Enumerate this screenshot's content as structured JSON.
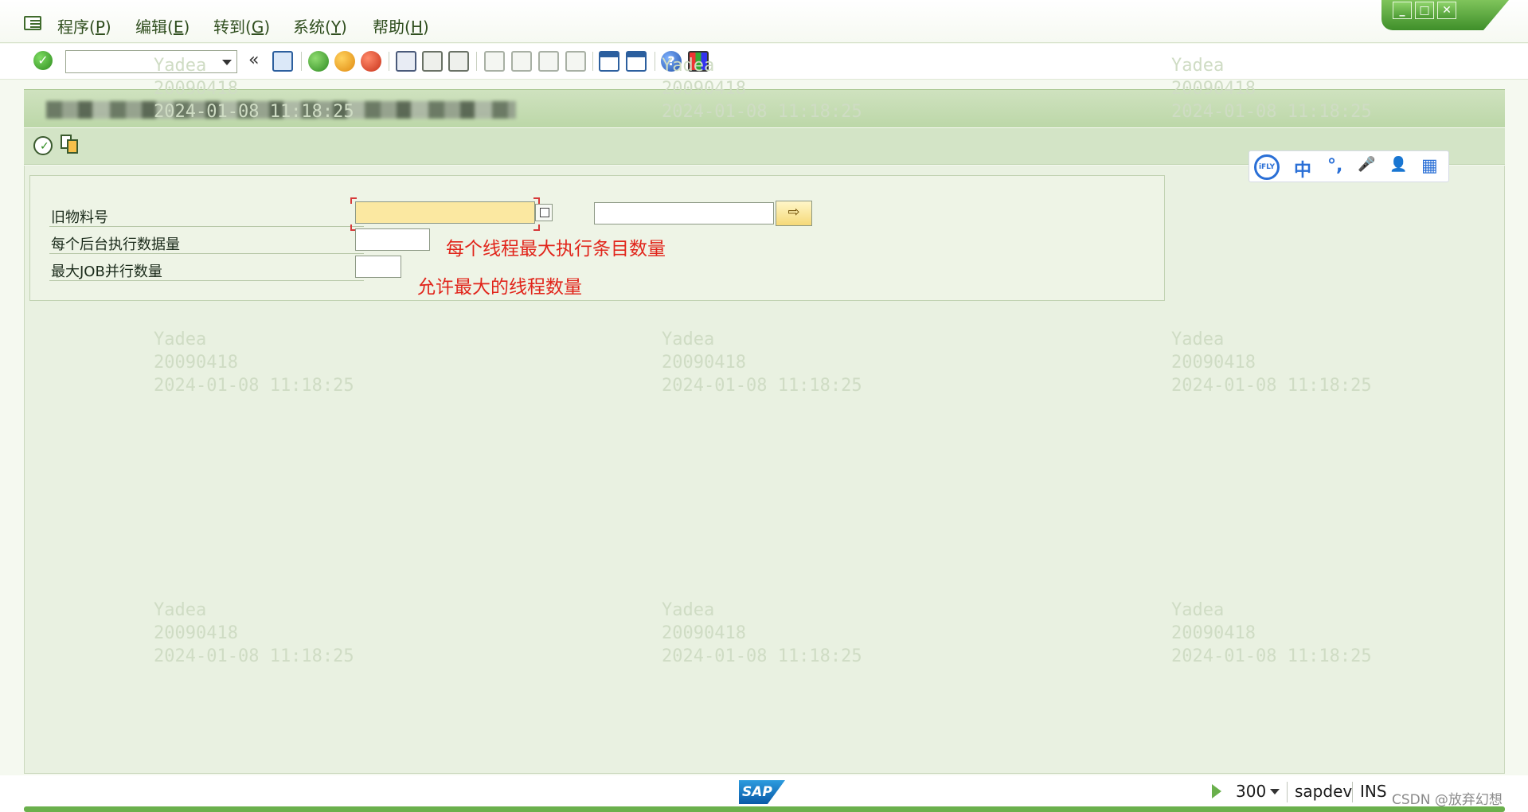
{
  "menu": {
    "items": [
      {
        "label": "程序(",
        "key": "P",
        "suffix": ")"
      },
      {
        "label": "编辑(",
        "key": "E",
        "suffix": ")"
      },
      {
        "label": "转到(",
        "key": "G",
        "suffix": ")"
      },
      {
        "label": "系统(",
        "key": "Y",
        "suffix": ")"
      },
      {
        "label": "帮助(",
        "key": "H",
        "suffix": ")"
      }
    ]
  },
  "toolbar": {
    "command_field_value": "",
    "icons": [
      "enter-icon",
      "save-icon",
      "back-icon",
      "exit-icon",
      "cancel-icon",
      "print-icon",
      "find-icon",
      "find-next-icon",
      "first-page-icon",
      "previous-page-icon",
      "next-page-icon",
      "last-page-icon",
      "new-session-icon",
      "shortcut-icon",
      "help-icon",
      "layout-icon"
    ]
  },
  "form": {
    "rows": [
      {
        "label": "旧物料号",
        "value_from": "",
        "value_to": ""
      },
      {
        "label": "每个后台执行数据量",
        "value": ""
      },
      {
        "label": "最大JOB并行数量",
        "value": ""
      }
    ],
    "annotations": [
      "每个线程最大执行条目数量",
      "允许最大的线程数量"
    ]
  },
  "watermark": {
    "lines": [
      "Yadea",
      "20090418",
      "2024-01-08 11:18:25"
    ]
  },
  "ifly": {
    "logo": "iFLY",
    "items": [
      "中",
      "°,",
      "🎤",
      "👤",
      "▦"
    ]
  },
  "status": {
    "sap_logo": "SAP",
    "client": "300",
    "server": "sapdev",
    "mode": "INS",
    "credit": "CSDN @放弃幻想"
  }
}
